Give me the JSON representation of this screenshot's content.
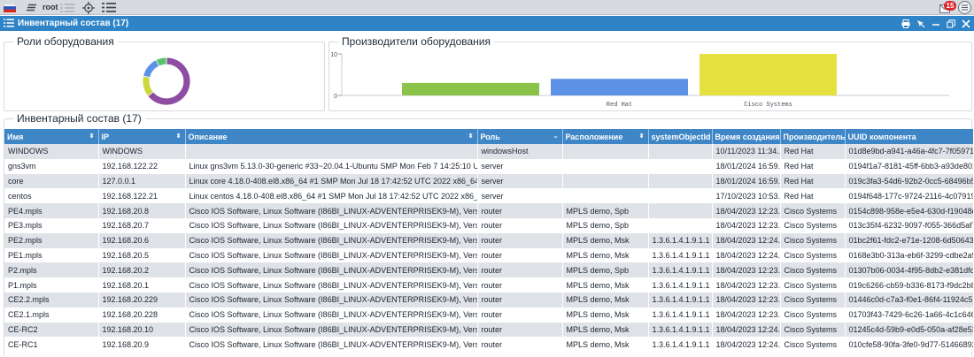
{
  "toolbar": {
    "user_label": "root",
    "notification_count": "15"
  },
  "window": {
    "title": "Инвентарный состав (17)"
  },
  "roles_panel": {
    "title": "Роли оборудования",
    "chart_data": {
      "type": "pie",
      "slices": [
        {
          "value": 9,
          "color": "#8e4ca2"
        },
        {
          "value": 2,
          "color": "#cdd83c"
        },
        {
          "value": 2,
          "color": "#5d93e6"
        },
        {
          "value": 1,
          "color": "#57c26b"
        }
      ]
    }
  },
  "vendors_panel": {
    "title": "Производители оборудования",
    "chart_data": {
      "type": "bar",
      "categories": [
        "",
        "Red Hat",
        "Cisco Systems"
      ],
      "values": [
        3,
        4,
        10
      ],
      "colors": [
        "#8bc34a",
        "#5d93e6",
        "#e6e03f"
      ],
      "yticks": [
        "0",
        "10"
      ],
      "ylim": [
        0,
        10
      ],
      "grid": false
    }
  },
  "inventory_panel": {
    "title": "Инвентарный состав (17)",
    "columns": [
      "Имя",
      "IP",
      "Описание",
      "Роль",
      "Расположение",
      "systemObjectId",
      "Время создания",
      "Производитель",
      "UUID компонента"
    ],
    "rows": [
      [
        "WINDOWS",
        "WINDOWS",
        "",
        "windowsHost",
        "",
        "",
        "10/11/2023 11:34...",
        "Red Hat",
        "01d8e9bd-a941-a46a-4fc7-7f059713b"
      ],
      [
        "gns3vm",
        "192.168.122.22",
        "Linux gns3vm 5.13.0-30-generic #33~20.04.1-Ubuntu SMP Mon Feb 7 14:25:10 UTC 202...",
        "server",
        "",
        "",
        "18/01/2024 16:59...",
        "Red Hat",
        "0194f1a7-8181-45ff-6bb3-a93de8026"
      ],
      [
        "core",
        "127.0.0.1",
        "Linux core 4.18.0-408.el8.x86_64 #1 SMP Mon Jul 18 17:42:52 UTC 2022 x86_64 x86_6...",
        "server",
        "",
        "",
        "18/01/2024 16:59...",
        "Red Hat",
        "019c3fa3-54d6-92b2-0cc5-68496b52b"
      ],
      [
        "centos",
        "192.168.122.21",
        "Linux centos 4.18.0-408.el8.x86_64 #1 SMP Mon Jul 18 17:42:52 UTC 2022 x86_64 x86_...",
        "server",
        "",
        "",
        "17/10/2023 10:53...",
        "Red Hat",
        "0194f648-177c-9724-2116-4c07919f3"
      ],
      [
        "PE4.mpls",
        "192.168.20.8",
        "Cisco IOS Software, Linux Software (I86BI_LINUX-ADVENTERPRISEK9-M), Version 15.5(...",
        "router",
        "MPLS demo, Spb",
        "",
        "18/04/2023 12:23...",
        "Cisco Systems",
        "0154c898-958e-e5e4-630d-f19048dde"
      ],
      [
        "PE3.mpls",
        "192.168.20.7",
        "Cisco IOS Software, Linux Software (I86BI_LINUX-ADVENTERPRISEK9-M), Version 15.5(...",
        "router",
        "MPLS demo, Spb",
        "",
        "18/04/2023 12:23...",
        "Cisco Systems",
        "013c35f4-6232-9097-f055-366d5af79"
      ],
      [
        "PE2.mpls",
        "192.168.20.6",
        "Cisco IOS Software, Linux Software (I86BI_LINUX-ADVENTERPRISEK9-M), Version 15.5(...",
        "router",
        "MPLS demo, Msk",
        "1.3.6.1.4.1.9.1.1",
        "18/04/2023 12:24...",
        "Cisco Systems",
        "01bc2f61-fdc2-e71e-1208-6d5064301"
      ],
      [
        "PE1.mpls",
        "192.168.20.5",
        "Cisco IOS Software, Linux Software (I86BI_LINUX-ADVENTERPRISEK9-M), Version 15.5(...",
        "router",
        "MPLS demo, Msk",
        "1.3.6.1.4.1.9.1.1",
        "18/04/2023 12:24...",
        "Cisco Systems",
        "0168e3b0-313a-eb6f-3299-cdbe2a942"
      ],
      [
        "P2.mpls",
        "192.168.20.2",
        "Cisco IOS Software, Linux Software (I86BI_LINUX-ADVENTERPRISEK9-M), Version 15.5(...",
        "router",
        "MPLS demo, Spb",
        "1.3.6.1.4.1.9.1.1",
        "18/04/2023 12:23...",
        "Cisco Systems",
        "01307b06-0034-4f95-8db2-e381dfc75"
      ],
      [
        "P1.mpls",
        "192.168.20.1",
        "Cisco IOS Software, Linux Software (I86BI_LINUX-ADVENTERPRISEK9-M), Version 15.5(...",
        "router",
        "MPLS demo, Msk",
        "1.3.6.1.4.1.9.1.1",
        "18/04/2023 12:23...",
        "Cisco Systems",
        "019c6266-cb59-b336-8173-f9dc2b8a"
      ],
      [
        "CE2.2.mpls",
        "192.168.20.229",
        "Cisco IOS Software, Linux Software (I86BI_LINUX-ADVENTERPRISEK9-M), Version 15.5(...",
        "router",
        "MPLS demo, Msk",
        "1.3.6.1.4.1.9.1.1",
        "18/04/2023 12:23...",
        "Cisco Systems",
        "01446c0d-c7a3-f0e1-86f4-11924c5a1"
      ],
      [
        "CE2.1.mpls",
        "192.168.20.228",
        "Cisco IOS Software, Linux Software (I86BI_LINUX-ADVENTERPRISEK9-M), Version 15.5(...",
        "router",
        "MPLS demo, Msk",
        "1.3.6.1.4.1.9.1.1",
        "18/04/2023 12:23...",
        "Cisco Systems",
        "01703f43-7429-6c26-1a66-4c1c64635"
      ],
      [
        "CE-RC2",
        "192.168.20.10",
        "Cisco IOS Software, Linux Software (I86BI_LINUX-ADVENTERPRISEK9-M), Version 15.5(...",
        "router",
        "MPLS demo, Msk",
        "1.3.6.1.4.1.9.1.1",
        "18/04/2023 12:24...",
        "Cisco Systems",
        "01245c4d-59b9-e0d5-050a-af28e53b4"
      ],
      [
        "CE-RC1",
        "192.168.20.9",
        "Cisco IOS Software, Linux Software (I86BI_LINUX-ADVENTERPRISEK9-M), Version 15.5(...",
        "router",
        "MPLS demo, Msk",
        "1.3.6.1.4.1.9.1.1",
        "18/04/2023 12:24...",
        "Cisco Systems",
        "010cfe58-90fa-3fe0-9d77-514668924"
      ]
    ]
  }
}
